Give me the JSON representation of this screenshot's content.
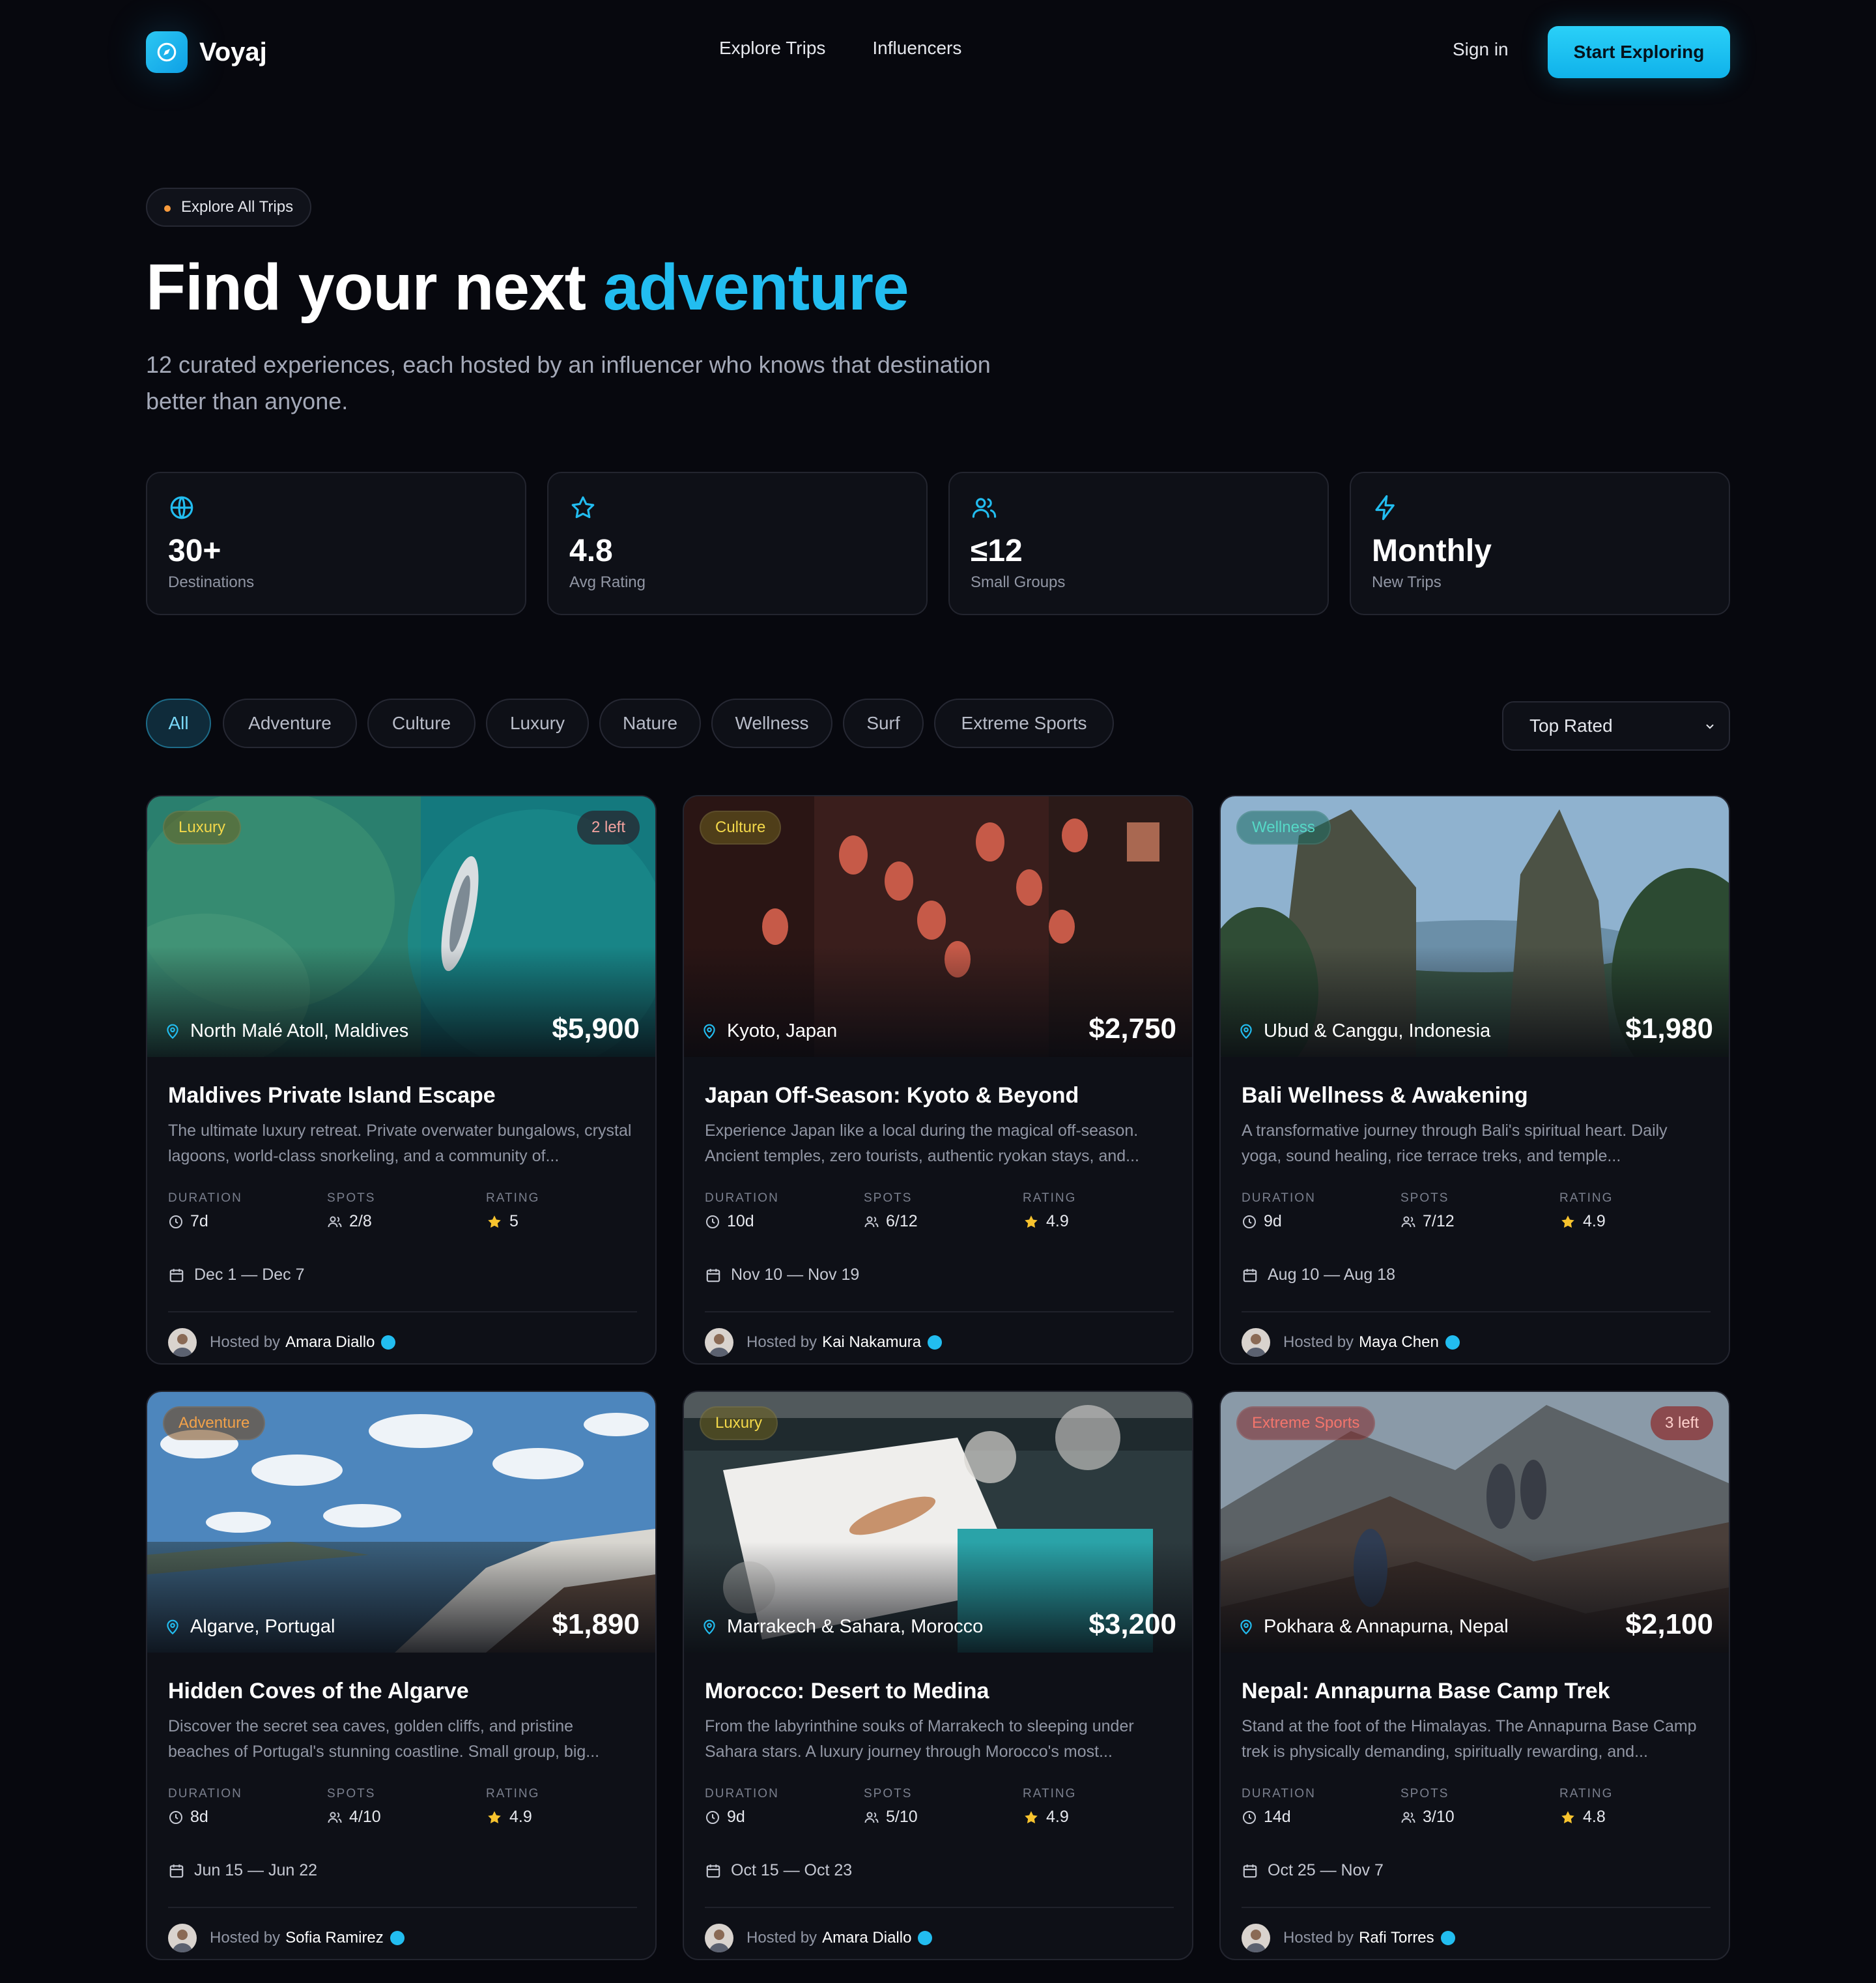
{
  "brand": {
    "name": "Voyaj"
  },
  "nav": {
    "links": [
      "Explore Trips",
      "Influencers"
    ],
    "sign_in": "Sign in",
    "cta": "Start Exploring"
  },
  "hero": {
    "pill": "Explore All Trips",
    "title_main": "Find your next ",
    "title_accent": "adventure",
    "subtitle": "12 curated experiences, each hosted by an influencer who knows that destination better than anyone."
  },
  "stats": [
    {
      "icon": "globe-icon",
      "value": "30+",
      "label": "Destinations"
    },
    {
      "icon": "star-icon",
      "value": "4.8",
      "label": "Avg Rating"
    },
    {
      "icon": "users-icon",
      "value": "≤12",
      "label": "Small Groups"
    },
    {
      "icon": "lightning-icon",
      "value": "Monthly",
      "label": "New Trips"
    }
  ],
  "filters": {
    "chips": [
      "All",
      "Adventure",
      "Culture",
      "Luxury",
      "Nature",
      "Wellness",
      "Surf",
      "Extreme Sports"
    ],
    "active": "All",
    "sort": "Top Rated"
  },
  "labels": {
    "duration": "DURATION",
    "spots": "SPOTS",
    "rating": "RATING",
    "hosted_by": "Hosted by"
  },
  "trips": [
    {
      "category": "Luxury",
      "spots_left": "2 left",
      "location": "North Malé Atoll, Maldives",
      "price": "$5,900",
      "title": "Maldives Private Island Escape",
      "description": "The ultimate luxury retreat. Private overwater bungalows, crystal lagoons, world-class snorkeling, and a community of...",
      "duration": "7d",
      "spots": "2/8",
      "rating": "5",
      "dates": "Dec 1 — Dec 7",
      "host": "Amara Diallo"
    },
    {
      "category": "Culture",
      "spots_left": "",
      "location": "Kyoto, Japan",
      "price": "$2,750",
      "title": "Japan Off-Season: Kyoto & Beyond",
      "description": "Experience Japan like a local during the magical off-season. Ancient temples, zero tourists, authentic ryokan stays, and...",
      "duration": "10d",
      "spots": "6/12",
      "rating": "4.9",
      "dates": "Nov 10 — Nov 19",
      "host": "Kai Nakamura"
    },
    {
      "category": "Wellness",
      "spots_left": "",
      "location": "Ubud & Canggu, Indonesia",
      "price": "$1,980",
      "title": "Bali Wellness & Awakening",
      "description": "A transformative journey through Bali's spiritual heart. Daily yoga, sound healing, rice terrace treks, and temple...",
      "duration": "9d",
      "spots": "7/12",
      "rating": "4.9",
      "dates": "Aug 10 — Aug 18",
      "host": "Maya Chen"
    },
    {
      "category": "Adventure",
      "spots_left": "",
      "location": "Algarve, Portugal",
      "price": "$1,890",
      "title": "Hidden Coves of the Algarve",
      "description": "Discover the secret sea caves, golden cliffs, and pristine beaches of Portugal's stunning coastline. Small group, big...",
      "duration": "8d",
      "spots": "4/10",
      "rating": "4.9",
      "dates": "Jun 15 — Jun 22",
      "host": "Sofia Ramirez"
    },
    {
      "category": "Luxury",
      "spots_left": "",
      "location": "Marrakech & Sahara, Morocco",
      "price": "$3,200",
      "title": "Morocco: Desert to Medina",
      "description": "From the labyrinthine souks of Marrakech to sleeping under Sahara stars. A luxury journey through Morocco's most...",
      "duration": "9d",
      "spots": "5/10",
      "rating": "4.9",
      "dates": "Oct 15 — Oct 23",
      "host": "Amara Diallo"
    },
    {
      "category": "Extreme Sports",
      "spots_left": "3 left",
      "location": "Pokhara & Annapurna, Nepal",
      "price": "$2,100",
      "title": "Nepal: Annapurna Base Camp Trek",
      "description": "Stand at the foot of the Himalayas. The Annapurna Base Camp trek is physically demanding, spiritually rewarding, and...",
      "duration": "14d",
      "spots": "3/10",
      "rating": "4.8",
      "dates": "Oct 25 — Nov 7",
      "host": "Rafi Torres"
    }
  ]
}
